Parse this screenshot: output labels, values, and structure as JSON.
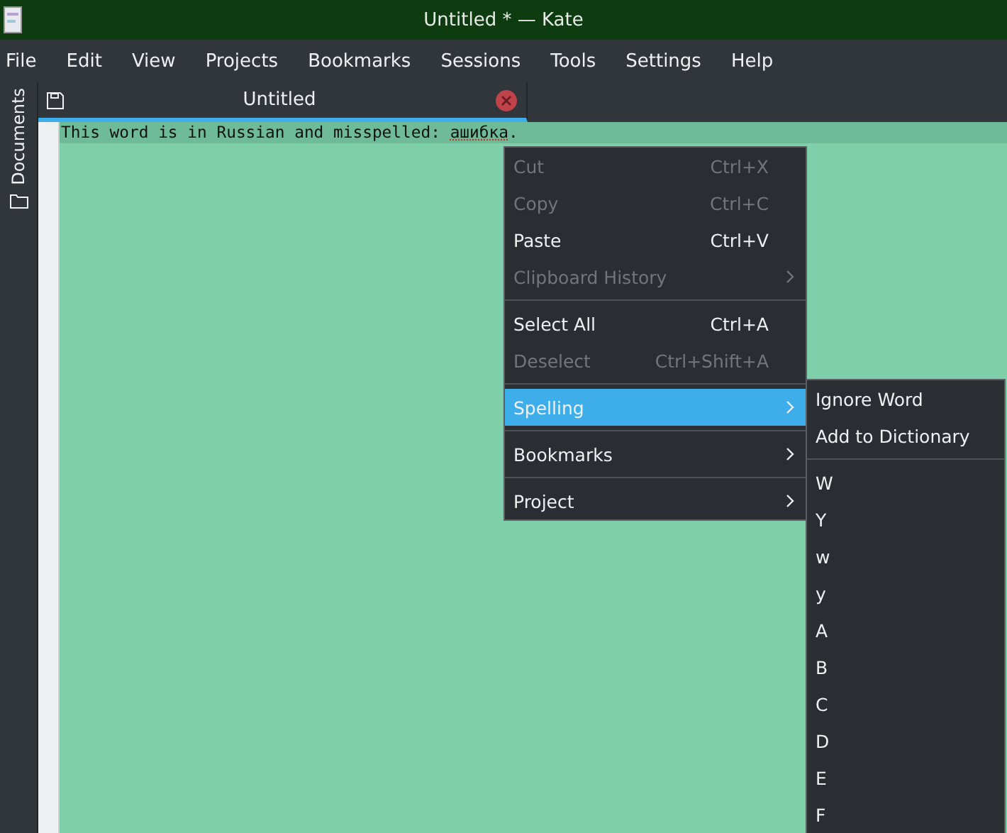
{
  "window": {
    "title": "Untitled * — Kate"
  },
  "menubar": [
    "File",
    "Edit",
    "View",
    "Projects",
    "Bookmarks",
    "Sessions",
    "Tools",
    "Settings",
    "Help"
  ],
  "sidebar": {
    "items": [
      {
        "label": "Documents"
      }
    ]
  },
  "tabs": [
    {
      "label": "Untitled",
      "selected": true
    }
  ],
  "editor": {
    "line": {
      "before": "This word is in Russian and misspelled: ",
      "misspelled": "ашибка",
      "after": "."
    }
  },
  "context_menu": {
    "groups": [
      [
        {
          "label": "Cut",
          "shortcut": "Ctrl+X",
          "disabled": true,
          "submenu": false,
          "selected": false
        },
        {
          "label": "Copy",
          "shortcut": "Ctrl+C",
          "disabled": true,
          "submenu": false,
          "selected": false
        },
        {
          "label": "Paste",
          "shortcut": "Ctrl+V",
          "disabled": false,
          "submenu": false,
          "selected": false
        },
        {
          "label": "Clipboard History",
          "disabled": true,
          "submenu": true,
          "selected": false
        }
      ],
      [
        {
          "label": "Select All",
          "shortcut": "Ctrl+A",
          "disabled": false,
          "submenu": false,
          "selected": false
        },
        {
          "label": "Deselect",
          "shortcut": "Ctrl+Shift+A",
          "disabled": true,
          "submenu": false,
          "selected": false
        }
      ],
      [
        {
          "label": "Spelling",
          "disabled": false,
          "submenu": true,
          "selected": true
        }
      ],
      [
        {
          "label": "Bookmarks",
          "disabled": false,
          "submenu": true,
          "selected": false
        }
      ],
      [
        {
          "label": "Project",
          "disabled": false,
          "submenu": true,
          "selected": false
        }
      ]
    ]
  },
  "spelling_submenu": {
    "groups": [
      [
        {
          "label": "Ignore Word"
        },
        {
          "label": "Add to Dictionary"
        }
      ],
      [
        {
          "label": "W"
        },
        {
          "label": "Y"
        },
        {
          "label": "w"
        },
        {
          "label": "y"
        },
        {
          "label": "A"
        },
        {
          "label": "B"
        },
        {
          "label": "C"
        },
        {
          "label": "D"
        },
        {
          "label": "E"
        },
        {
          "label": "F"
        }
      ]
    ]
  }
}
